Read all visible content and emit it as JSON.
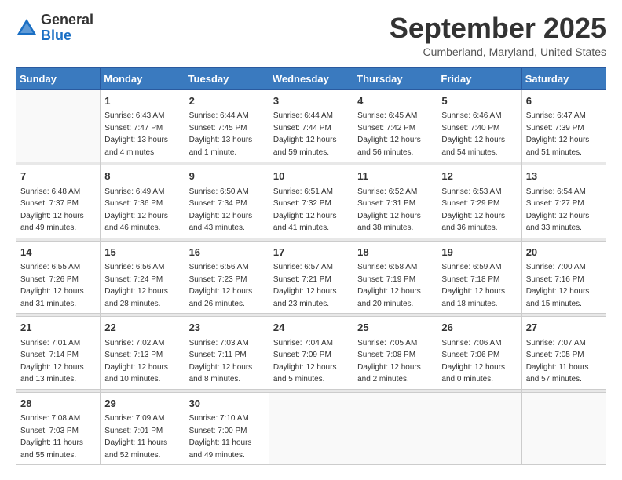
{
  "header": {
    "logo_general": "General",
    "logo_blue": "Blue",
    "month": "September 2025",
    "location": "Cumberland, Maryland, United States"
  },
  "weekdays": [
    "Sunday",
    "Monday",
    "Tuesday",
    "Wednesday",
    "Thursday",
    "Friday",
    "Saturday"
  ],
  "weeks": [
    [
      {
        "day": "",
        "info": ""
      },
      {
        "day": "1",
        "info": "Sunrise: 6:43 AM\nSunset: 7:47 PM\nDaylight: 13 hours\nand 4 minutes."
      },
      {
        "day": "2",
        "info": "Sunrise: 6:44 AM\nSunset: 7:45 PM\nDaylight: 13 hours\nand 1 minute."
      },
      {
        "day": "3",
        "info": "Sunrise: 6:44 AM\nSunset: 7:44 PM\nDaylight: 12 hours\nand 59 minutes."
      },
      {
        "day": "4",
        "info": "Sunrise: 6:45 AM\nSunset: 7:42 PM\nDaylight: 12 hours\nand 56 minutes."
      },
      {
        "day": "5",
        "info": "Sunrise: 6:46 AM\nSunset: 7:40 PM\nDaylight: 12 hours\nand 54 minutes."
      },
      {
        "day": "6",
        "info": "Sunrise: 6:47 AM\nSunset: 7:39 PM\nDaylight: 12 hours\nand 51 minutes."
      }
    ],
    [
      {
        "day": "7",
        "info": "Sunrise: 6:48 AM\nSunset: 7:37 PM\nDaylight: 12 hours\nand 49 minutes."
      },
      {
        "day": "8",
        "info": "Sunrise: 6:49 AM\nSunset: 7:36 PM\nDaylight: 12 hours\nand 46 minutes."
      },
      {
        "day": "9",
        "info": "Sunrise: 6:50 AM\nSunset: 7:34 PM\nDaylight: 12 hours\nand 43 minutes."
      },
      {
        "day": "10",
        "info": "Sunrise: 6:51 AM\nSunset: 7:32 PM\nDaylight: 12 hours\nand 41 minutes."
      },
      {
        "day": "11",
        "info": "Sunrise: 6:52 AM\nSunset: 7:31 PM\nDaylight: 12 hours\nand 38 minutes."
      },
      {
        "day": "12",
        "info": "Sunrise: 6:53 AM\nSunset: 7:29 PM\nDaylight: 12 hours\nand 36 minutes."
      },
      {
        "day": "13",
        "info": "Sunrise: 6:54 AM\nSunset: 7:27 PM\nDaylight: 12 hours\nand 33 minutes."
      }
    ],
    [
      {
        "day": "14",
        "info": "Sunrise: 6:55 AM\nSunset: 7:26 PM\nDaylight: 12 hours\nand 31 minutes."
      },
      {
        "day": "15",
        "info": "Sunrise: 6:56 AM\nSunset: 7:24 PM\nDaylight: 12 hours\nand 28 minutes."
      },
      {
        "day": "16",
        "info": "Sunrise: 6:56 AM\nSunset: 7:23 PM\nDaylight: 12 hours\nand 26 minutes."
      },
      {
        "day": "17",
        "info": "Sunrise: 6:57 AM\nSunset: 7:21 PM\nDaylight: 12 hours\nand 23 minutes."
      },
      {
        "day": "18",
        "info": "Sunrise: 6:58 AM\nSunset: 7:19 PM\nDaylight: 12 hours\nand 20 minutes."
      },
      {
        "day": "19",
        "info": "Sunrise: 6:59 AM\nSunset: 7:18 PM\nDaylight: 12 hours\nand 18 minutes."
      },
      {
        "day": "20",
        "info": "Sunrise: 7:00 AM\nSunset: 7:16 PM\nDaylight: 12 hours\nand 15 minutes."
      }
    ],
    [
      {
        "day": "21",
        "info": "Sunrise: 7:01 AM\nSunset: 7:14 PM\nDaylight: 12 hours\nand 13 minutes."
      },
      {
        "day": "22",
        "info": "Sunrise: 7:02 AM\nSunset: 7:13 PM\nDaylight: 12 hours\nand 10 minutes."
      },
      {
        "day": "23",
        "info": "Sunrise: 7:03 AM\nSunset: 7:11 PM\nDaylight: 12 hours\nand 8 minutes."
      },
      {
        "day": "24",
        "info": "Sunrise: 7:04 AM\nSunset: 7:09 PM\nDaylight: 12 hours\nand 5 minutes."
      },
      {
        "day": "25",
        "info": "Sunrise: 7:05 AM\nSunset: 7:08 PM\nDaylight: 12 hours\nand 2 minutes."
      },
      {
        "day": "26",
        "info": "Sunrise: 7:06 AM\nSunset: 7:06 PM\nDaylight: 12 hours\nand 0 minutes."
      },
      {
        "day": "27",
        "info": "Sunrise: 7:07 AM\nSunset: 7:05 PM\nDaylight: 11 hours\nand 57 minutes."
      }
    ],
    [
      {
        "day": "28",
        "info": "Sunrise: 7:08 AM\nSunset: 7:03 PM\nDaylight: 11 hours\nand 55 minutes."
      },
      {
        "day": "29",
        "info": "Sunrise: 7:09 AM\nSunset: 7:01 PM\nDaylight: 11 hours\nand 52 minutes."
      },
      {
        "day": "30",
        "info": "Sunrise: 7:10 AM\nSunset: 7:00 PM\nDaylight: 11 hours\nand 49 minutes."
      },
      {
        "day": "",
        "info": ""
      },
      {
        "day": "",
        "info": ""
      },
      {
        "day": "",
        "info": ""
      },
      {
        "day": "",
        "info": ""
      }
    ]
  ]
}
